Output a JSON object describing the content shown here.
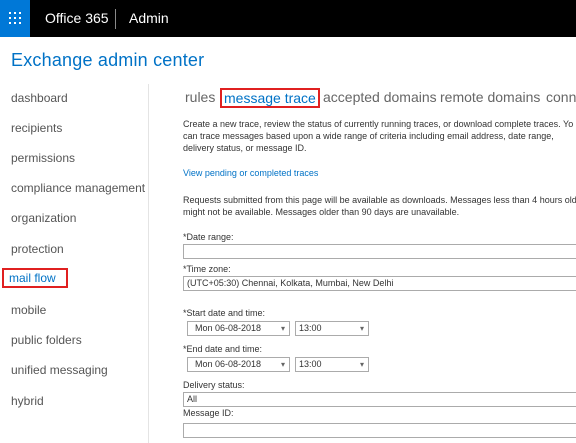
{
  "topbar": {
    "app_name": "Office 365",
    "section_name": "Admin",
    "accent_color": "#0078d7"
  },
  "title": "Exchange admin center",
  "sidebar": {
    "items": [
      {
        "label": "dashboard"
      },
      {
        "label": "recipients"
      },
      {
        "label": "permissions"
      },
      {
        "label": "compliance management"
      },
      {
        "label": "organization"
      },
      {
        "label": "protection"
      },
      {
        "label": "mail flow",
        "active": true
      },
      {
        "label": "mobile"
      },
      {
        "label": "public folders"
      },
      {
        "label": "unified messaging"
      },
      {
        "label": "hybrid"
      }
    ]
  },
  "tabs": [
    {
      "label": "rules"
    },
    {
      "label": "message trace",
      "active": true
    },
    {
      "label": "accepted domains"
    },
    {
      "label": "remote domains"
    },
    {
      "label": "conn"
    }
  ],
  "main": {
    "intro_lines": [
      "Create a new trace, review the status of currently running traces, or download complete traces. Yo",
      "can trace messages based upon a wide range of criteria including email address, date range,",
      "delivery status, or message ID."
    ],
    "pending_link": "View pending or completed traces",
    "note_lines": [
      "Requests submitted from this page will be available as downloads. Messages less than 4 hours old",
      "might not be available. Messages older than 90 days are unavailable."
    ],
    "date_range_label": "*Date range:",
    "date_range_value": "",
    "time_zone_label": "*Time zone:",
    "time_zone_value": "(UTC+05:30) Chennai, Kolkata, Mumbai, New Delhi",
    "start_label": "*Start date and time:",
    "start_date": "Mon 06-08-2018",
    "start_time": "13:00",
    "end_label": "*End date and time:",
    "end_date": "Mon 06-08-2018",
    "end_time": "13:00",
    "delivery_label": "Delivery status:",
    "delivery_value": "All",
    "message_id_label": "Message ID:",
    "message_id_value": ""
  },
  "icons": {
    "waffle": "app-launcher-icon",
    "dropdown": "chevron-down-icon"
  }
}
